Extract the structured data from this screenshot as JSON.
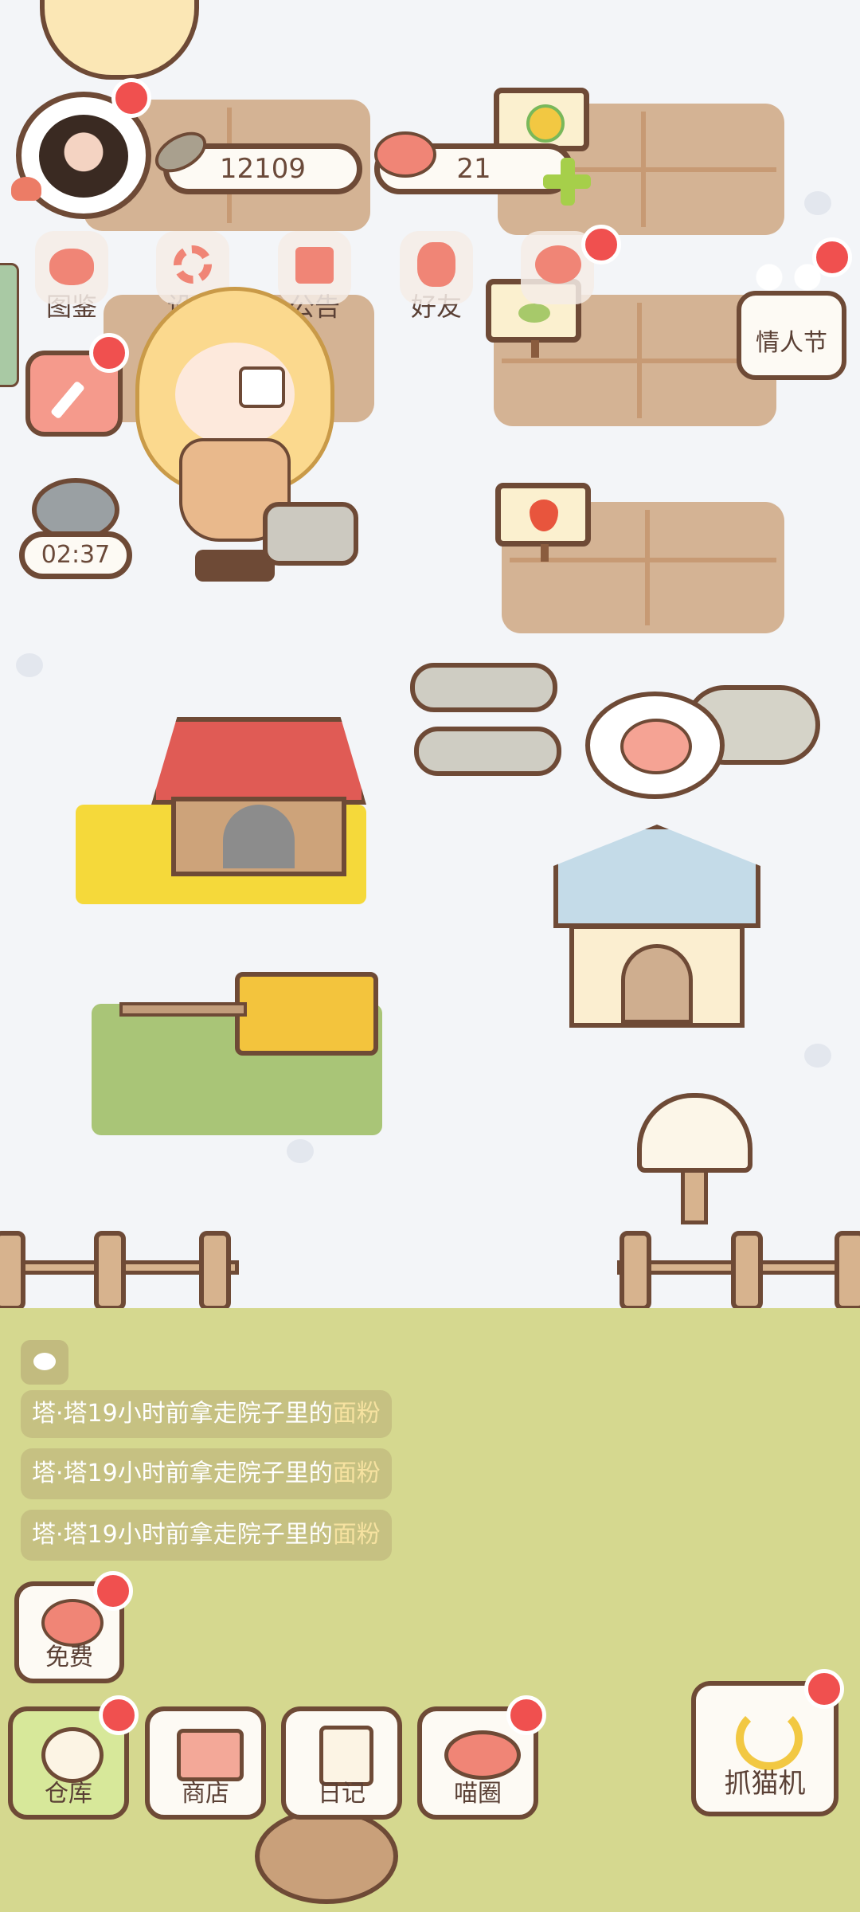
{
  "player": {
    "coins": "12109",
    "hearts": "21"
  },
  "menu": [
    {
      "key": "atlas",
      "label": "图鉴",
      "icon": "cat-head-icon"
    },
    {
      "key": "settings",
      "label": "设置",
      "icon": "gear-icon"
    },
    {
      "key": "notice",
      "label": "公告",
      "icon": "gift-icon"
    },
    {
      "key": "friends",
      "label": "好友",
      "icon": "friends-icon"
    },
    {
      "key": "hidden",
      "label": "",
      "icon": "heart-icon"
    }
  ],
  "event": {
    "label": "情人节"
  },
  "timer": "02:37",
  "feed": [
    {
      "prefix": "塔·塔19小时前拿走院子里的",
      "item": "面粉"
    },
    {
      "prefix": "塔·塔19小时前拿走院子里的",
      "item": "面粉"
    },
    {
      "prefix": "塔·塔19小时前拿走院子里的",
      "item": "面粉"
    }
  ],
  "bottom": {
    "free": "免费",
    "warehouse": "仓库",
    "shop": "商店",
    "diary": "日记",
    "circle": "喵圈",
    "claw": "抓猫机"
  },
  "colors": {
    "badge": "#f0504f",
    "grass": "#d5d88f",
    "outline": "#6e4a36"
  }
}
